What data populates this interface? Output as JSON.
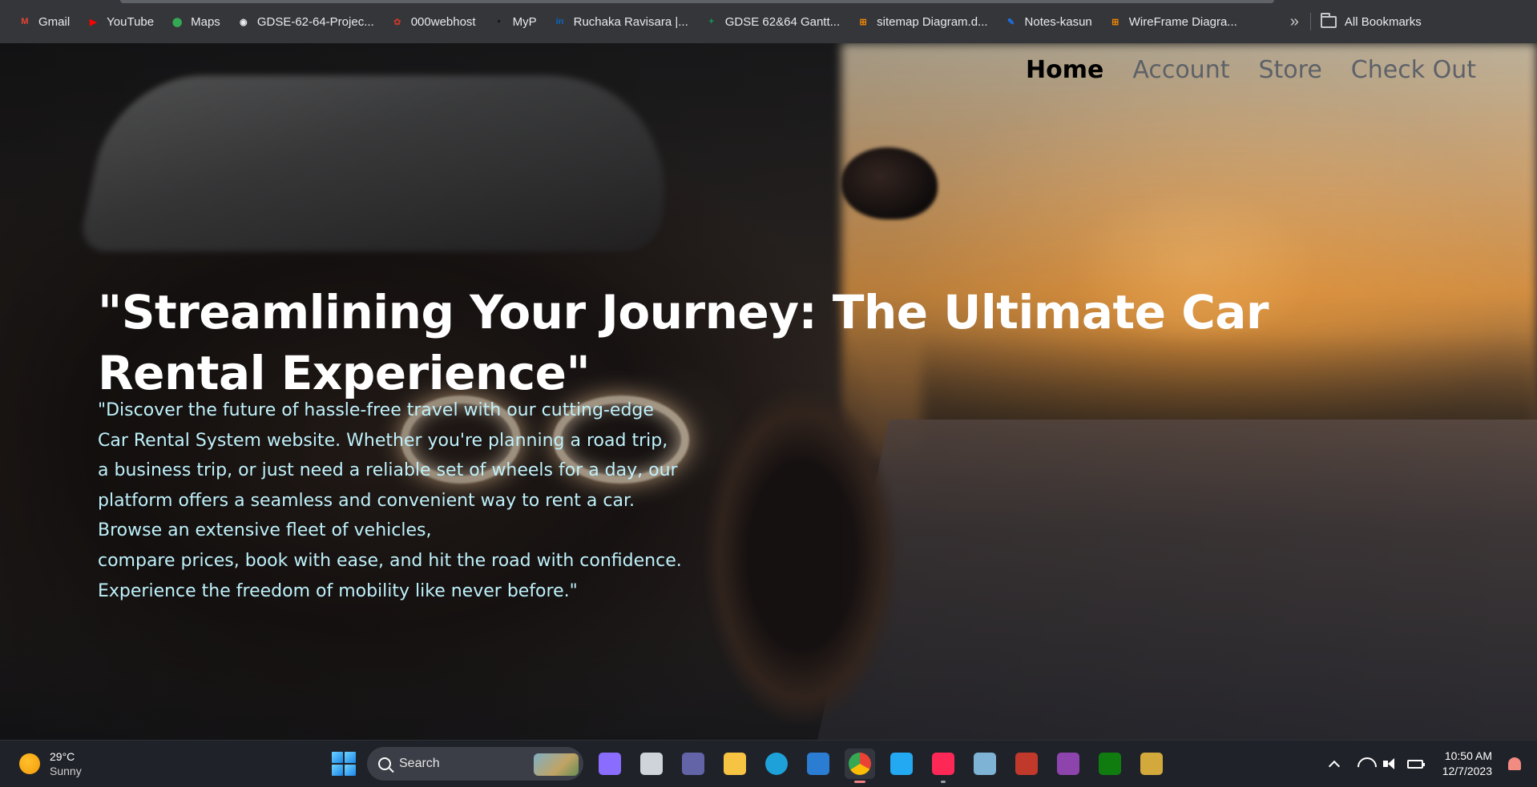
{
  "bookmarks": {
    "items": [
      {
        "label": "Gmail",
        "icon": "gmail-icon",
        "color": "#ea4335",
        "glyph": "M"
      },
      {
        "label": "YouTube",
        "icon": "youtube-icon",
        "color": "#ff0000",
        "glyph": "▶"
      },
      {
        "label": "Maps",
        "icon": "maps-icon",
        "color": "#34a853",
        "glyph": "⬤"
      },
      {
        "label": "GDSE-62-64-Projec...",
        "icon": "github-icon",
        "color": "#e8eaed",
        "glyph": "◉"
      },
      {
        "label": "000webhost",
        "icon": "webhost-icon",
        "color": "#c0392b",
        "glyph": "✿"
      },
      {
        "label": "MyP",
        "icon": "myp-icon",
        "color": "#111111",
        "glyph": "▪"
      },
      {
        "label": "Ruchaka Ravisara |...",
        "icon": "linkedin-icon",
        "color": "#0a66c2",
        "glyph": "in"
      },
      {
        "label": "GDSE 62&64 Gantt...",
        "icon": "sheets-icon",
        "color": "#0f9d58",
        "glyph": "+"
      },
      {
        "label": "sitemap Diagram.d...",
        "icon": "drawio-icon",
        "color": "#f08705",
        "glyph": "⊞"
      },
      {
        "label": "Notes-kasun",
        "icon": "notes-icon",
        "color": "#1a73e8",
        "glyph": "✎"
      },
      {
        "label": "WireFrame Diagra...",
        "icon": "drawio-icon",
        "color": "#f08705",
        "glyph": "⊞"
      }
    ],
    "more": "»",
    "all_bookmarks": "All Bookmarks"
  },
  "nav": {
    "home": "Home",
    "account": "Account",
    "store": "Store",
    "checkout": "Check Out"
  },
  "hero": {
    "headline": "\"Streamlining Your Journey: The Ultimate Car Rental Experience\"",
    "intro": "\"Discover the future of hassle-free travel with our cutting-edge\nCar Rental System website. Whether you're planning a road trip,\na business trip, or just need a reliable set of wheels for a day, our\nplatform offers a seamless and convenient way to rent a car.\nBrowse an extensive fleet of vehicles,\ncompare prices, book with ease, and hit the road with confidence.\nExperience the freedom of mobility like never before.\""
  },
  "taskbar": {
    "weather": {
      "temp": "29°C",
      "condition": "Sunny"
    },
    "search_label": "Search",
    "apps": [
      {
        "name": "copilot-icon",
        "color": "#8a6cff"
      },
      {
        "name": "task-view-icon",
        "color": "#cfd3da"
      },
      {
        "name": "teams-icon",
        "color": "#6264a7"
      },
      {
        "name": "file-explorer-icon",
        "color": "#f6c342"
      },
      {
        "name": "edge-icon",
        "color": "#1ea0d8"
      },
      {
        "name": "store-icon",
        "color": "#2b7cd3"
      },
      {
        "name": "chrome-icon",
        "color": "#34a853"
      },
      {
        "name": "vscode-icon",
        "color": "#23a9f2"
      },
      {
        "name": "intellij-icon",
        "color": "#fe2857"
      },
      {
        "name": "monitor-app-icon",
        "color": "#7fb3d5"
      },
      {
        "name": "red-app-icon",
        "color": "#c0392b"
      },
      {
        "name": "purple-app-icon",
        "color": "#8e44ad"
      },
      {
        "name": "xbox-icon",
        "color": "#107c10"
      },
      {
        "name": "powertoys-icon",
        "color": "#d4a93c"
      }
    ],
    "clock": {
      "time": "10:50 AM",
      "date": "12/7/2023"
    }
  }
}
